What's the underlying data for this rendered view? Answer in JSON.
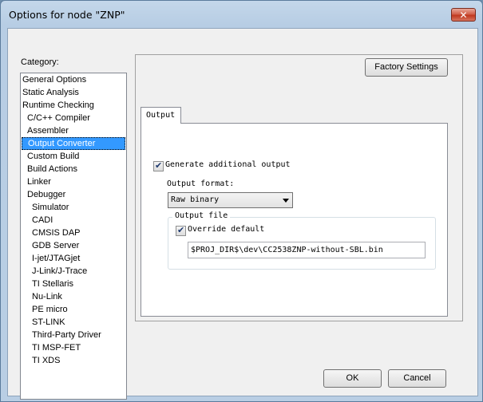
{
  "window": {
    "title": "Options for node \"ZNP\"",
    "close_glyph": "✕"
  },
  "category": {
    "label": "Category:",
    "items": [
      {
        "label": "General Options",
        "level": 0
      },
      {
        "label": "Static Analysis",
        "level": 0
      },
      {
        "label": "Runtime Checking",
        "level": 0
      },
      {
        "label": "C/C++ Compiler",
        "level": 1
      },
      {
        "label": "Assembler",
        "level": 1
      },
      {
        "label": "Output Converter",
        "level": 1,
        "selected": true
      },
      {
        "label": "Custom Build",
        "level": 1
      },
      {
        "label": "Build Actions",
        "level": 1
      },
      {
        "label": "Linker",
        "level": 1
      },
      {
        "label": "Debugger",
        "level": 1
      },
      {
        "label": "Simulator",
        "level": 2
      },
      {
        "label": "CADI",
        "level": 2
      },
      {
        "label": "CMSIS DAP",
        "level": 2
      },
      {
        "label": "GDB Server",
        "level": 2
      },
      {
        "label": "I-jet/JTAGjet",
        "level": 2
      },
      {
        "label": "J-Link/J-Trace",
        "level": 2
      },
      {
        "label": "TI Stellaris",
        "level": 2
      },
      {
        "label": "Nu-Link",
        "level": 2
      },
      {
        "label": "PE micro",
        "level": 2
      },
      {
        "label": "ST-LINK",
        "level": 2
      },
      {
        "label": "Third-Party Driver",
        "level": 2
      },
      {
        "label": "TI MSP-FET",
        "level": 2
      },
      {
        "label": "TI XDS",
        "level": 2
      }
    ]
  },
  "panel": {
    "factory_settings_label": "Factory Settings",
    "tab_label": "Output",
    "generate_output": {
      "label": "Generate additional output",
      "checked": true
    },
    "output_format": {
      "label": "Output format:",
      "value": "Raw binary"
    },
    "output_file": {
      "legend": "Output file",
      "override": {
        "label": "Override default",
        "checked": true
      },
      "path": "$PROJ_DIR$\\dev\\CC2538ZNP-without-SBL.bin"
    }
  },
  "buttons": {
    "ok_label": "OK",
    "cancel_label": "Cancel"
  },
  "glyphs": {
    "check": "✔"
  },
  "colors": {
    "selection": "#3399ff",
    "title_bar": "#b9cee4",
    "close_button": "#c0391f"
  }
}
